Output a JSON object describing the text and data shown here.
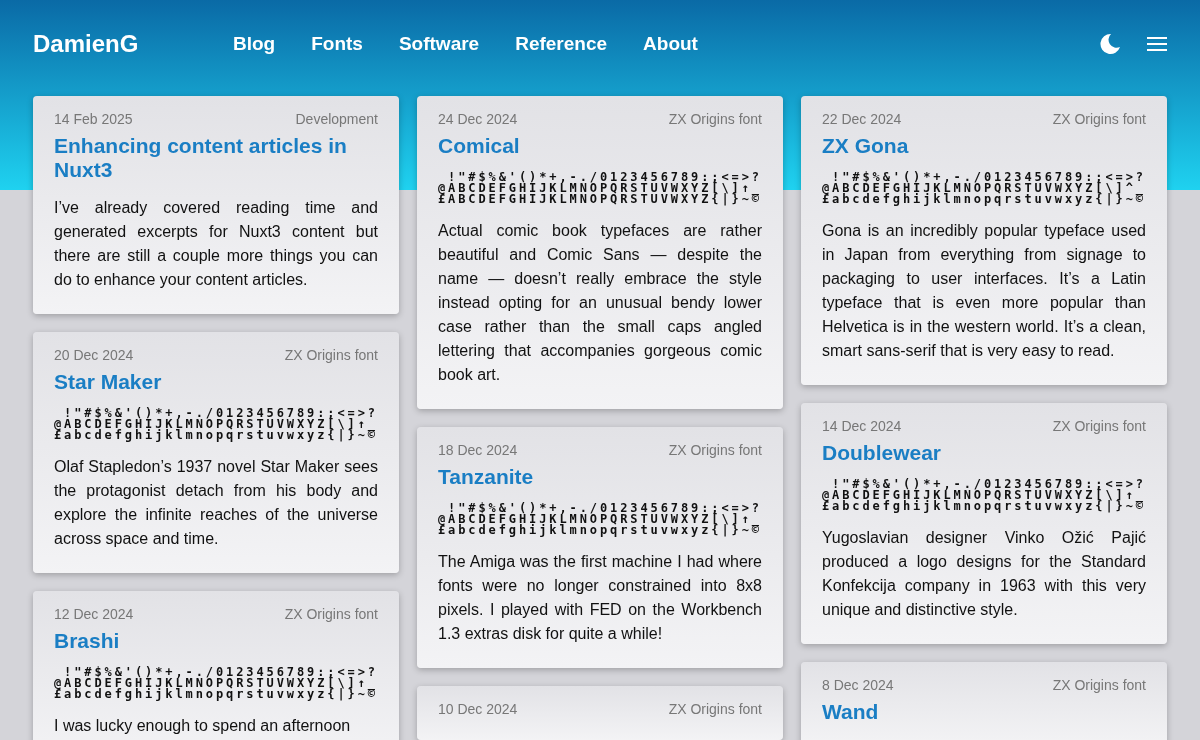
{
  "header": {
    "logo": "DamienG",
    "nav": [
      {
        "label": "Blog"
      },
      {
        "label": "Fonts"
      },
      {
        "label": "Software"
      },
      {
        "label": "Reference"
      },
      {
        "label": "About"
      }
    ]
  },
  "columns": [
    {
      "posts": [
        {
          "date": "14 Feb 2025",
          "category": "Development",
          "title": "Enhancing content articles in Nuxt3",
          "summary": "I’ve already covered reading time and generated excerpts for Nuxt3 content but there are still a couple more things you can do to enhance your content articles."
        },
        {
          "date": "20 Dec 2024",
          "category": "ZX Origins font",
          "title": "Star Maker",
          "specimen": [
            " !\"#$%&'()*+,-./0123456789:;<=>?",
            "@ABCDEFGHIJKLMNOPQRSTUVWXYZ[\\]↑_",
            "£abcdefghijklmnopqrstuvwxyz{|}~©"
          ],
          "summary": "Olaf Stapledon’s 1937 novel Star Maker sees the protagonist detach from his body and explore the infinite reaches of the universe across space and time."
        },
        {
          "date": "12 Dec 2024",
          "category": "ZX Origins font",
          "title": "Brashi",
          "specimen": [
            " !\"#$%&'()*+,-./0123456789:;<=>?",
            "@ABCDEFGHIJKLMNOPQRSTUVWXYZ[\\]↑_",
            "£abcdefghijklmnopqrstuvwxyz{|}~©"
          ],
          "summary": "I was lucky enough to spend an afternoon"
        }
      ]
    },
    {
      "posts": [
        {
          "date": "24 Dec 2024",
          "category": "ZX Origins font",
          "title": "Comical",
          "specimen": [
            " !\"#$%&'()*+,-./0123456789:;<=>?",
            "@ABCDEFGHIJKLMNOPQRSTUVWXYZ[\\]↑_",
            "£ABCDEFGHIJKLMNOPQRSTUVWXYZ{|}~©"
          ],
          "summary": "Actual comic book typefaces are rather beautiful and Comic Sans — despite the name — doesn’t really embrace the style instead opting for an unusual bendy lower case rather than the small caps angled lettering that accompanies gorgeous comic book art."
        },
        {
          "date": "18 Dec 2024",
          "category": "ZX Origins font",
          "title": "Tanzanite",
          "specimen": [
            " !\"#$%&'()*+,-./0123456789:;<=>?",
            "@ABCDEFGHIJKLMNOPQRSTUVWXYZ[\\]↑_",
            "£abcdefghijklmnopqrstuvwxyz{|}~©"
          ],
          "summary": "The Amiga was the first machine I had where fonts were no longer constrained into 8x8 pixels. I played with FED on the Workbench 1.3 extras disk for quite a while!"
        },
        {
          "date": "10 Dec 2024",
          "category": "ZX Origins font"
        }
      ]
    },
    {
      "posts": [
        {
          "date": "22 Dec 2024",
          "category": "ZX Origins font",
          "title": "ZX Gona",
          "specimen": [
            " !\"#$%&'()*+,-./0123456789:;<=>?",
            "@ABCDEFGHIJKLMNOPQRSTUVWXYZ[\\]^_",
            "£abcdefghijklmnopqrstuvwxyz{|}~©"
          ],
          "summary": "Gona is an incredibly popular typeface used in Japan from everything from signage to packaging to user interfaces. It’s a Latin typeface that is even more popular than Helvetica is in the western world. It’s a clean, smart sans-serif that is very easy to read."
        },
        {
          "date": "14 Dec 2024",
          "category": "ZX Origins font",
          "title": "Doublewear",
          "specimen": [
            " !\"#$%&'()*+,-./0123456789:;<=>?",
            "@ABCDEFGHIJKLMNOPQRSTUVWXYZ[\\]↑_",
            "£abcdefghijklmnopqrstuvwxyz{|}~©"
          ],
          "summary": "Yugoslavian designer Vinko Ožić Pajić produced a logo designs for the Standard Konfekcija company in 1963 with this very unique and distinctive style."
        },
        {
          "date": "8 Dec 2024",
          "category": "ZX Origins font",
          "title": "Wand"
        }
      ]
    }
  ]
}
